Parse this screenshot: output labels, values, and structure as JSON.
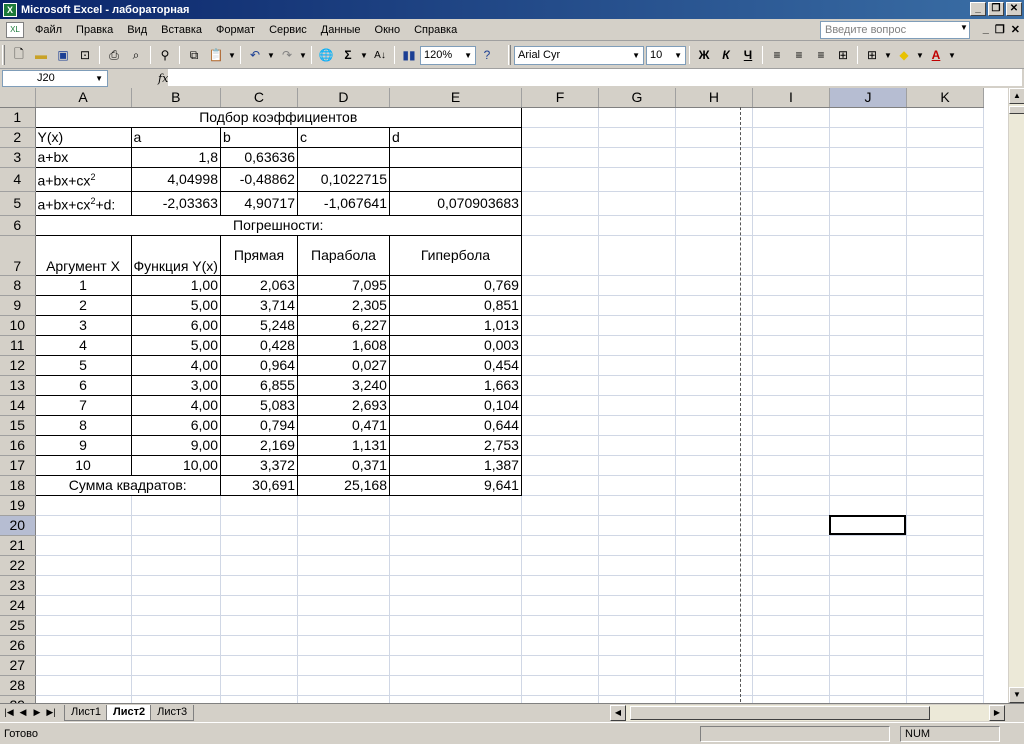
{
  "window": {
    "title": "Microsoft Excel - лабораторная"
  },
  "menu": {
    "items": [
      "Файл",
      "Правка",
      "Вид",
      "Вставка",
      "Формат",
      "Сервис",
      "Данные",
      "Окно",
      "Справка"
    ],
    "help_placeholder": "Введите вопрос"
  },
  "toolbar": {
    "zoom": "120%",
    "font": "Arial Cyr",
    "font_size": "10",
    "bold": "Ж",
    "italic": "К",
    "underline": "Ч"
  },
  "formula_bar": {
    "name_box": "J20",
    "fx": "fx",
    "formula": ""
  },
  "columns": [
    "A",
    "B",
    "C",
    "D",
    "E",
    "F",
    "G",
    "H",
    "I",
    "J",
    "K"
  ],
  "sheet": {
    "title": "Подбор коэффициентов",
    "coef_headers": [
      "Y(x)",
      "a",
      "b",
      "c",
      "d"
    ],
    "rows": {
      "r3": {
        "label": "a+bx",
        "a": "1,8",
        "b": "0,63636"
      },
      "r4": {
        "label": "a+bx+cx",
        "a": "4,04998",
        "b": "-0,48862",
        "c": "0,1022715"
      },
      "r5": {
        "label": "a+bx+cx",
        "label_tail": "+d:",
        "a": "-2,03363",
        "b": "4,90717",
        "c": "-1,067641",
        "d": "0,070903683"
      }
    },
    "sup": "2",
    "errors_title": "Погрешности:",
    "err_headers": [
      "Аргумент X",
      "Функция Y(x)",
      "Прямая",
      "Парабола",
      "Гипербола"
    ],
    "err_rows": [
      [
        "1",
        "1,00",
        "2,063",
        "7,095",
        "0,769"
      ],
      [
        "2",
        "5,00",
        "3,714",
        "2,305",
        "0,851"
      ],
      [
        "3",
        "6,00",
        "5,248",
        "6,227",
        "1,013"
      ],
      [
        "4",
        "5,00",
        "0,428",
        "1,608",
        "0,003"
      ],
      [
        "5",
        "4,00",
        "0,964",
        "0,027",
        "0,454"
      ],
      [
        "6",
        "3,00",
        "6,855",
        "3,240",
        "1,663"
      ],
      [
        "7",
        "4,00",
        "5,083",
        "2,693",
        "0,104"
      ],
      [
        "8",
        "6,00",
        "0,794",
        "0,471",
        "0,644"
      ],
      [
        "9",
        "9,00",
        "2,169",
        "1,131",
        "2,753"
      ],
      [
        "10",
        "10,00",
        "3,372",
        "0,371",
        "1,387"
      ]
    ],
    "sum_label": "Сумма квадратов:",
    "sums": [
      "30,691",
      "25,168",
      "9,641"
    ]
  },
  "tabs": [
    "Лист1",
    "Лист2",
    "Лист3"
  ],
  "active_tab": "Лист2",
  "status": {
    "ready": "Готово",
    "num": "NUM"
  }
}
